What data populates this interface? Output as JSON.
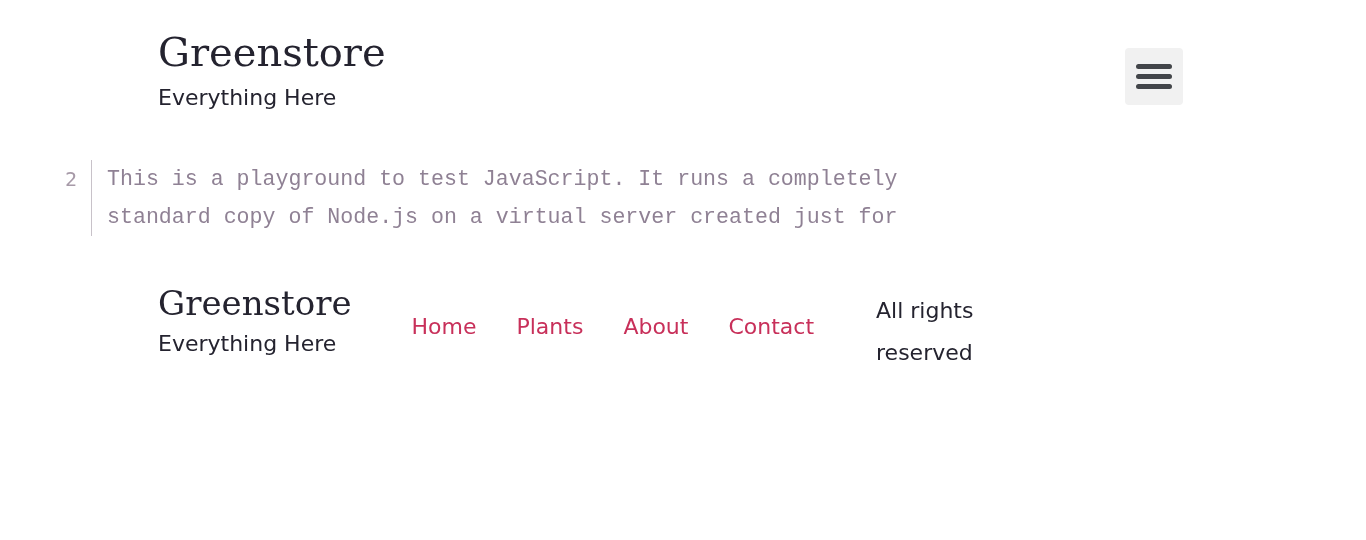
{
  "header": {
    "title": "Greenstore",
    "tagline": "Everything Here"
  },
  "code_editor": {
    "lines": [
      {
        "number": "2",
        "text": "This is a playground to test JavaScript. It runs a completely standard copy of Node.js on a virtual server created just for"
      }
    ]
  },
  "footer": {
    "title": "Greenstore",
    "tagline": "Everything Here",
    "nav": [
      "Home",
      "Plants",
      "About",
      "Contact"
    ],
    "notice": "All rights reserved"
  }
}
